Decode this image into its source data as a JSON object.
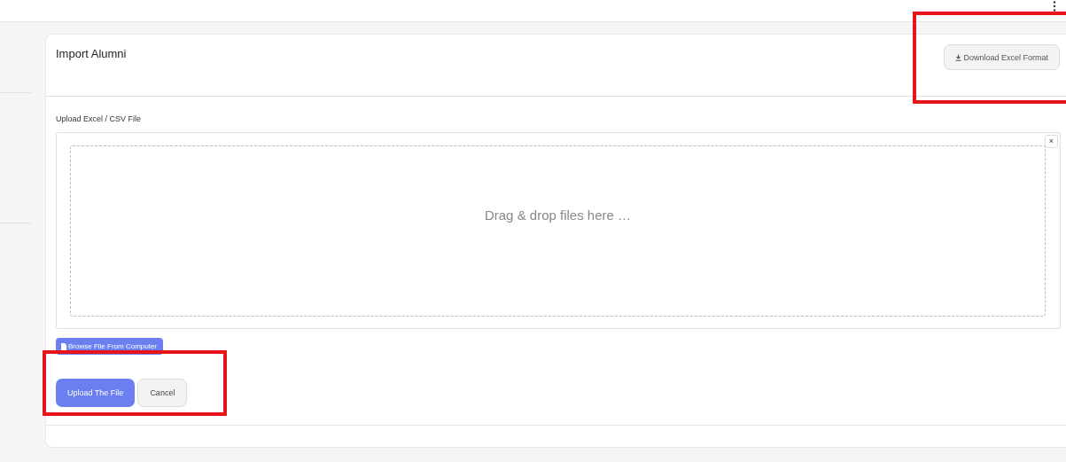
{
  "card": {
    "title": "Import Alumni",
    "download_button": "Download Excel Format"
  },
  "upload": {
    "label": "Upload Excel / CSV File",
    "dropzone_text": "Drag & drop files here …",
    "close": "×",
    "browse_button": "Browse File From Computer"
  },
  "actions": {
    "submit": "Upload The File",
    "cancel": "Cancel"
  }
}
